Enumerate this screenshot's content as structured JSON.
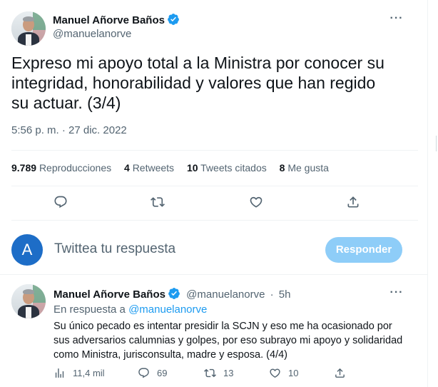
{
  "main_tweet": {
    "author_name": "Manuel Añorve Baños",
    "author_handle": "@manuelanorve",
    "text": "Expreso mi apoyo total a la Ministra por conocer su integridad, honorabilidad y valores que han regido su actuar. (3/4)",
    "timestamp": "5:56 p. m. · 27 dic. 2022",
    "stats": {
      "views_value": "9.789",
      "views_label": "Reproducciones",
      "retweets_value": "4",
      "retweets_label": "Retweets",
      "quotes_value": "10",
      "quotes_label": "Tweets citados",
      "likes_value": "8",
      "likes_label": "Me gusta"
    }
  },
  "reply_composer": {
    "avatar_letter": "A",
    "placeholder": "Twittea tu respuesta",
    "button_label": "Responder"
  },
  "reply_tweet": {
    "author_name": "Manuel Añorve Baños",
    "author_handle": "@manuelanorve",
    "separator": "·",
    "time": "5h",
    "in_reply_prefix": "En respuesta a",
    "in_reply_handle": "@manuelanorve",
    "text": "Su único pecado es intentar presidir la SCJN y eso me ha ocasionado por sus adversarios calumnias y golpes, por eso subrayo mi apoyo y solidaridad como Ministra, jurisconsulta, madre y esposa. (4/4)",
    "views": "11,4 mil",
    "replies": "69",
    "retweets": "13",
    "likes": "10"
  },
  "icons": [
    "more-icon",
    "verified-icon",
    "reply-icon",
    "retweet-icon",
    "like-icon",
    "share-icon",
    "views-icon"
  ],
  "colors": {
    "accent": "#1d9bf0",
    "button_disabled": "#8ecdf8",
    "secondary_text": "#536471",
    "composer_avatar": "#1d6dc7"
  }
}
